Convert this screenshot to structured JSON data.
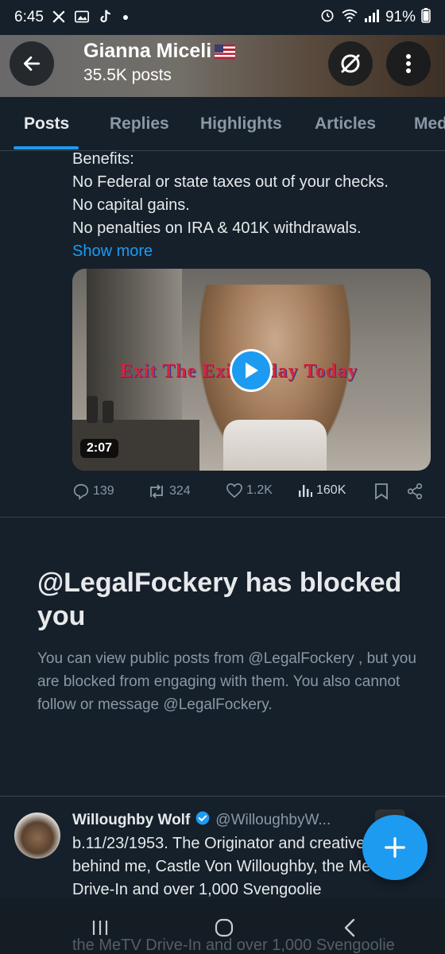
{
  "status_bar": {
    "time": "6:45",
    "battery": "91%",
    "icons": [
      "x-icon",
      "gallery-icon",
      "tiktok-icon",
      "alarm-icon",
      "wifi-icon",
      "signal-icon",
      "battery-icon"
    ]
  },
  "header": {
    "name": "Gianna Miceli",
    "posts_count": "35.5K posts",
    "icons": [
      "back-arrow-icon",
      "grok-icon",
      "more-vertical-icon"
    ]
  },
  "tabs": [
    {
      "label": "Posts",
      "active": true
    },
    {
      "label": "Replies",
      "active": false
    },
    {
      "label": "Highlights",
      "active": false
    },
    {
      "label": "Articles",
      "active": false
    },
    {
      "label": "Media",
      "active": false
    }
  ],
  "post": {
    "lines": [
      "Benefits:",
      "No Federal or state taxes out of your checks.",
      "No capital gains.",
      "No penalties on IRA & 401K withdrawals."
    ],
    "show_more": "Show more",
    "video": {
      "overlay_text": "Exit The Exit Today Today",
      "duration": "2:07"
    },
    "actions": {
      "replies": "139",
      "reposts": "324",
      "likes": "1.2K",
      "views": "160K"
    }
  },
  "blocked": {
    "title": "@LegalFockery has blocked you",
    "description": "You can view public posts from @LegalFockery , but you are blocked from engaging with them. You also cannot follow or message @LegalFockery."
  },
  "next_post": {
    "name": "Willoughby Wolf",
    "handle": "@WilloughbyW...",
    "text": "b.11/23/1953. The Originator and creative silliness behind me, Castle Von Willoughby, the MeTV Drive-In and over 1,000 Svengoolie",
    "ghost_text": "the MeTV Drive-In and over 1,000 Svengoolie"
  },
  "colors": {
    "background": "#15202b",
    "accent": "#1d9bf0",
    "secondary_text": "#8b98a5",
    "verified": "#1d9bf0"
  }
}
